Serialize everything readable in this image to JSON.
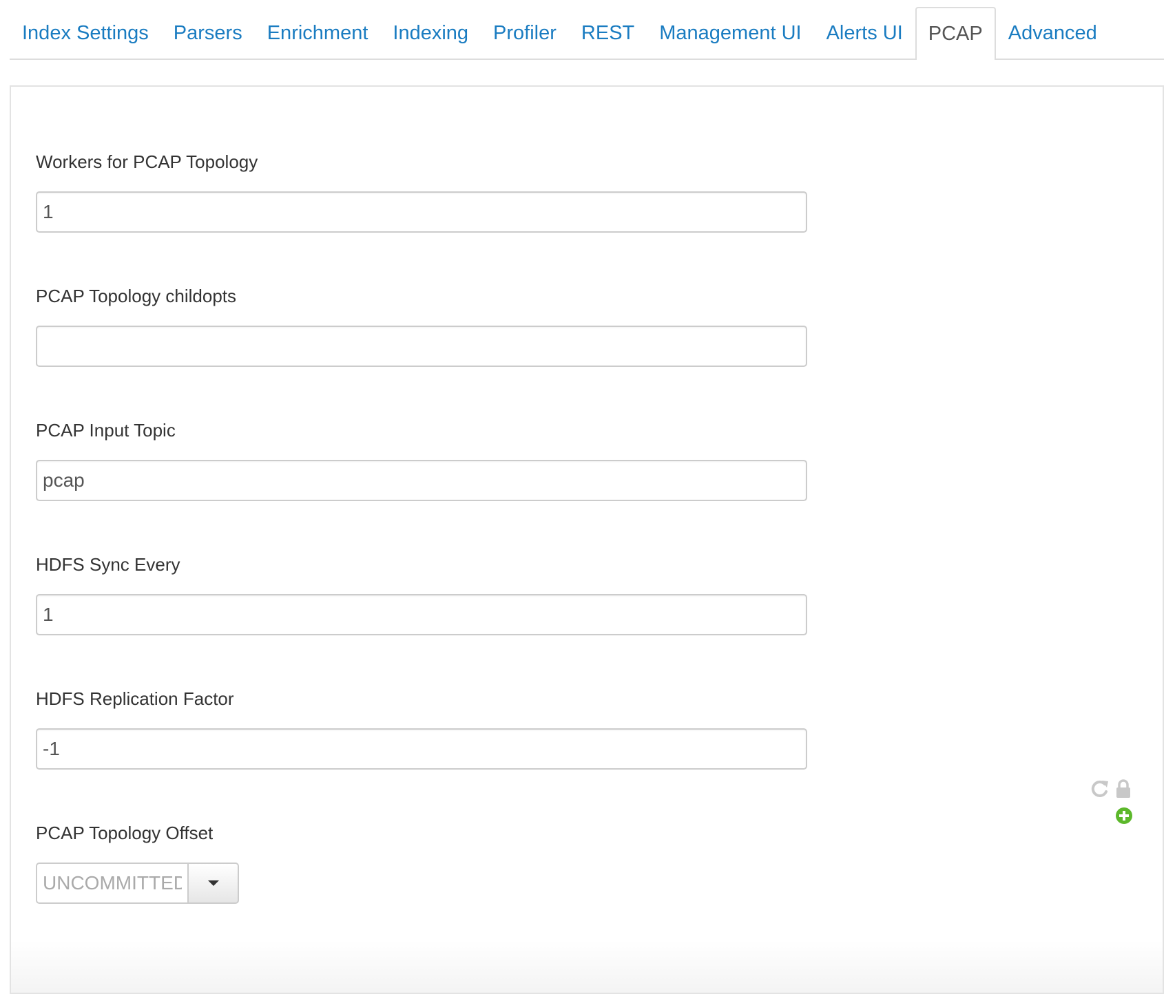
{
  "tabs": [
    {
      "label": "Index Settings"
    },
    {
      "label": "Parsers"
    },
    {
      "label": "Enrichment"
    },
    {
      "label": "Indexing"
    },
    {
      "label": "Profiler"
    },
    {
      "label": "REST"
    },
    {
      "label": "Management UI"
    },
    {
      "label": "Alerts UI"
    },
    {
      "label": "PCAP",
      "active": true
    },
    {
      "label": "Advanced"
    }
  ],
  "form": {
    "workers": {
      "label": "Workers for PCAP Topology",
      "value": "1"
    },
    "childopts": {
      "label": "PCAP Topology childopts",
      "value": ""
    },
    "input_topic": {
      "label": "PCAP Input Topic",
      "value": "pcap"
    },
    "sync_every": {
      "label": "HDFS Sync Every",
      "value": "1"
    },
    "replication": {
      "label": "HDFS Replication Factor",
      "value": "-1"
    },
    "offset": {
      "label": "PCAP Topology Offset",
      "value": "UNCOMMITTED_EARLIEST"
    }
  },
  "icons": {
    "refresh": "refresh-icon",
    "lock": "lock-icon",
    "add": "add-circle-icon"
  },
  "colors": {
    "link": "#1a7cc1",
    "active_tab": "#555555",
    "add_icon": "#5cb82b",
    "muted_icon": "#c8c8c8"
  }
}
